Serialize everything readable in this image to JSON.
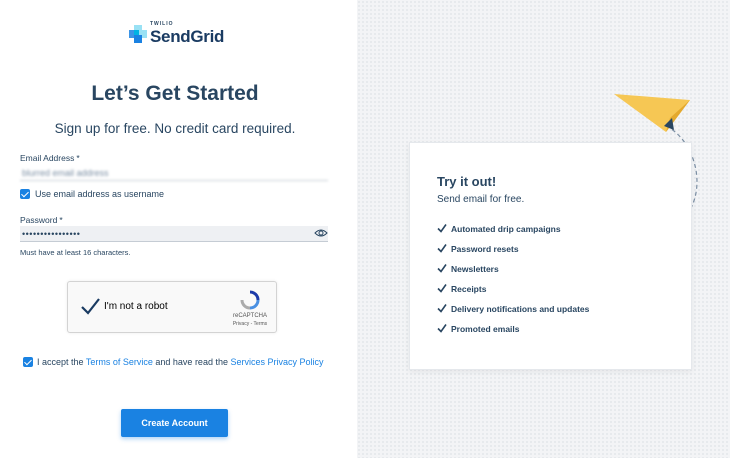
{
  "brand": {
    "twilio": "TWILIO",
    "name": "SendGrid",
    "colors": {
      "primary": "#1a82e2",
      "text": "#294661",
      "plane": "#f6c754"
    }
  },
  "signup": {
    "title": "Let’s Get Started",
    "subtitle": "Sign up for free. No credit card required.",
    "email": {
      "label": "Email Address",
      "required_mark": "*",
      "value": "blurred email address"
    },
    "use_email_as_username": {
      "label": "Use email address as username",
      "checked": true
    },
    "password": {
      "label": "Password",
      "required_mark": "*",
      "value": "••••••••••••••••",
      "hint": "Must have at least 16 characters."
    },
    "recaptcha": {
      "label": "I'm not a robot",
      "brand": "reCAPTCHA",
      "links": "Privacy - Terms"
    },
    "terms": {
      "checked": true,
      "prefix": "I accept the ",
      "tos_link": "Terms of Service",
      "middle": " and have read the ",
      "privacy_link": "Services Privacy Policy"
    },
    "submit_label": "Create Account"
  },
  "promo": {
    "title": "Try it out!",
    "subtitle": "Send email for free.",
    "features": [
      "Automated drip campaigns",
      "Password resets",
      "Newsletters",
      "Receipts",
      "Delivery notifications and updates",
      "Promoted emails"
    ]
  }
}
